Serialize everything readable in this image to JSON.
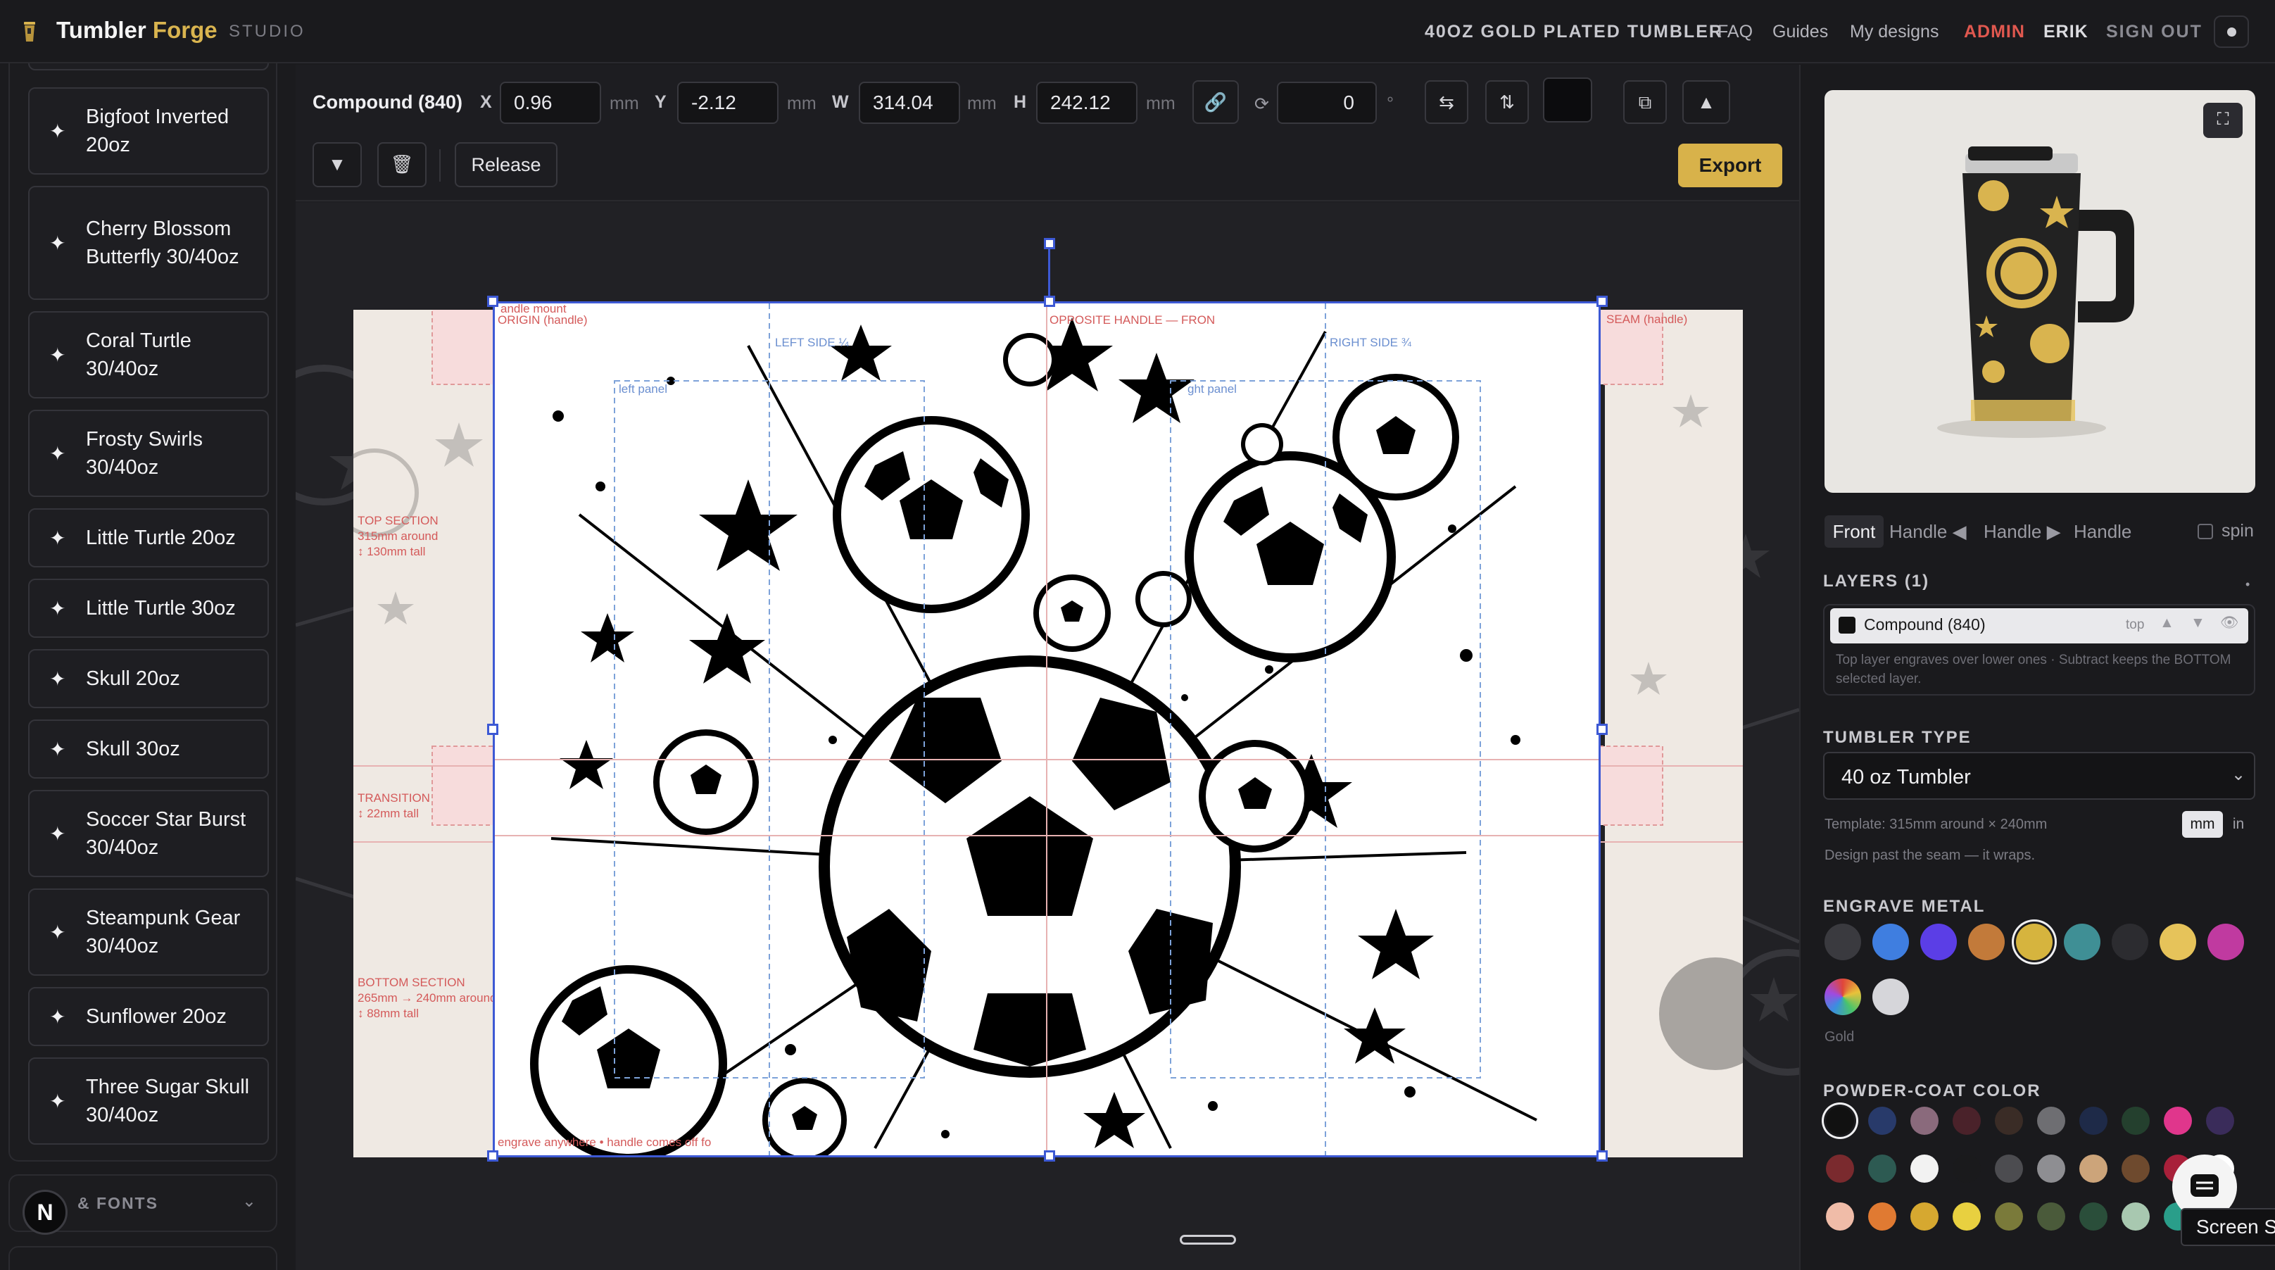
{
  "header": {
    "brand_word1": "Tumbler",
    "brand_word2": "Forge",
    "brand_sub": "STUDIO",
    "product": "40OZ GOLD PLATED TUMBLER",
    "faq": "FAQ",
    "guides": "Guides",
    "my_designs": "My designs",
    "admin": "ADMIN",
    "user": "ERIK",
    "sign_out": "SIGN OUT",
    "accent_color": "#d9b44f"
  },
  "sidebar": {
    "templates": [
      {
        "label": "Bigfoot Inverted 20oz"
      },
      {
        "label": "Cherry Blossom Butterfly 30/40oz"
      },
      {
        "label": "Coral Turtle 30/40oz"
      },
      {
        "label": "Frosty Swirls 30/40oz"
      },
      {
        "label": "Little Turtle 20oz"
      },
      {
        "label": "Little Turtle 30oz"
      },
      {
        "label": "Skull 20oz"
      },
      {
        "label": "Skull 30oz"
      },
      {
        "label": "Soccer Star Burst 30/40oz"
      },
      {
        "label": "Steampunk Gear 30/40oz"
      },
      {
        "label": "Sunflower 20oz"
      },
      {
        "label": "Three Sugar Skull 30/40oz"
      }
    ],
    "fonts_section": "& FONTS",
    "avatar_letter": "N"
  },
  "toolbar": {
    "selection": "Compound (840)",
    "x_label": "X",
    "x_value": "0.96",
    "y_label": "Y",
    "y_value": "-2.12",
    "w_label": "W",
    "w_value": "314.04",
    "h_label": "H",
    "h_value": "242.12",
    "unit": "mm",
    "rotation_value": "0",
    "degree": "°",
    "release": "Release",
    "export": "Export",
    "fill_color": "#0c0c0e"
  },
  "canvas": {
    "labels": {
      "origin": "ORIGIN (handle)",
      "seam": "SEAM (handle)",
      "left_side": "LEFT SIDE ¼",
      "opposite": "OPPOSITE HANDLE — FRON",
      "right_side": "RIGHT SIDE ¾",
      "left_panel": "left panel",
      "right_panel": "ght panel",
      "top_section": [
        "TOP SECTION",
        "315mm around",
        "↕ 130mm tall"
      ],
      "transition": [
        "TRANSITION",
        "↕ 22mm tall"
      ],
      "bottom_section": [
        "BOTTOM SECTION",
        "265mm → 240mm around",
        "↕ 88mm tall"
      ],
      "footer_note": "engrave anywhere • handle comes off fo",
      "handle_mount": "andle mount"
    }
  },
  "right_panel": {
    "view_tabs": [
      "Front",
      "Handle ◀",
      "Handle ▶",
      "Handle"
    ],
    "spin": "spin",
    "layers_title": "LAYERS (1)",
    "layer": {
      "name": "Compound (840)",
      "position": "top"
    },
    "layer_help": "Top layer engraves over lower ones · Subtract keeps the BOTTOM selected layer.",
    "tumbler_type_title": "TUMBLER TYPE",
    "tumbler_type": "40 oz Tumbler",
    "template_info": "Template: 315mm around × 240mm",
    "units": [
      "mm",
      "in"
    ],
    "wrap_note": "Design past the seam — it wraps.",
    "engrave_metal_title": "ENGRAVE METAL",
    "metal_colors": [
      "#3a3a3f",
      "#3f7ee0",
      "#5b3ee6",
      "#c27a3a",
      "#d6b43e",
      "#3f8f95",
      "#2c2c30",
      "#e6c35a",
      "#c03aa0",
      "rainbow",
      "#d6d6da"
    ],
    "selected_metal": "Gold",
    "powder_coat_title": "POWDER-COAT COLOR",
    "powder_colors_row1": [
      "#111111",
      "#283a6a",
      "#8a6a7c",
      "#4a222a",
      "#3a2c26",
      "#6e6e72",
      "#1e2a48",
      "#24402e",
      "#e0368c",
      "#3a2c5a"
    ],
    "powder_colors_row2": [
      "#7a2a2e",
      "#2d5a52",
      "#f2f2f2",
      "#1a1a1c",
      "#4c4c50",
      "#8e8e92",
      "#cca47a",
      "#6e4a2e",
      "#a8203a",
      "#ffffff"
    ],
    "powder_colors_row3": [
      "#f0bca8",
      "#e07a32",
      "#d6a830",
      "#e8d040",
      "#7a7a3a",
      "#4a5a3a",
      "#2a4e3a",
      "#a8c8b0",
      "#2a9e8a",
      "#888888"
    ],
    "tooltip": "Screen S"
  }
}
